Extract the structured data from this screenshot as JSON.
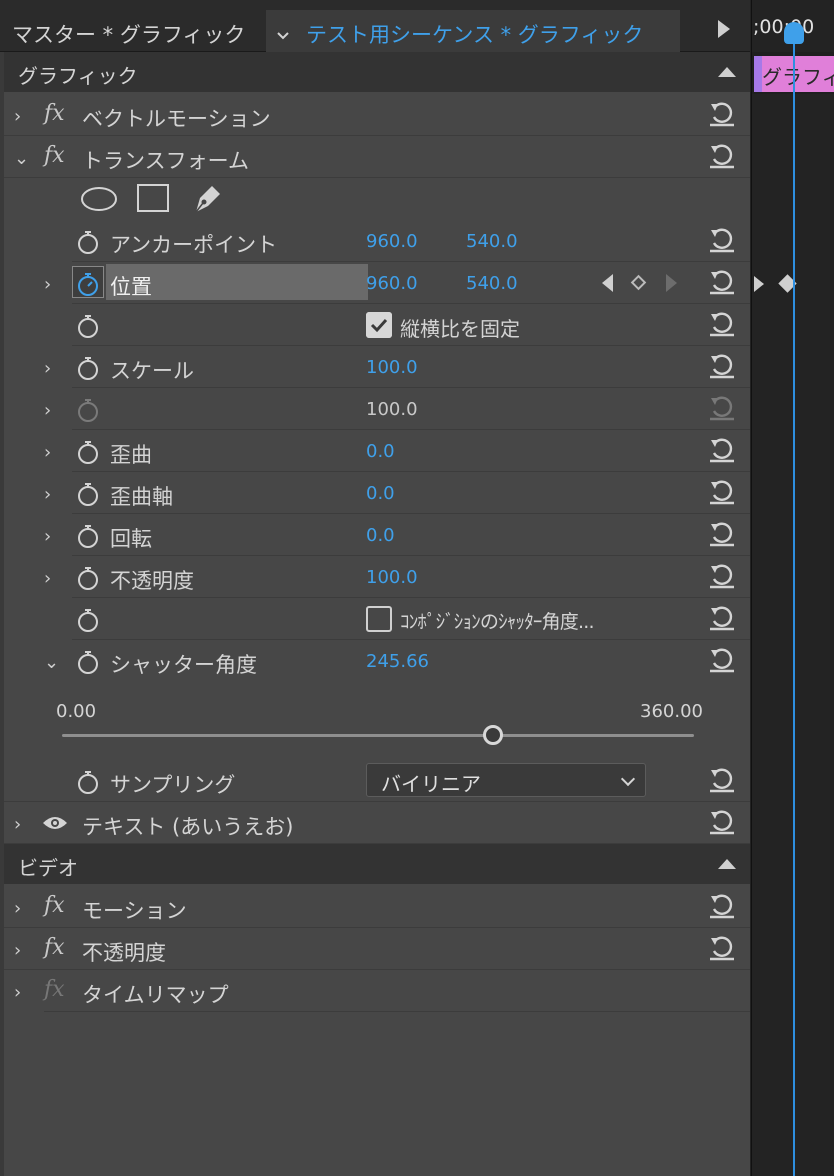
{
  "tabs": {
    "master": "マスター * グラフィック",
    "sequence": "テスト用シーケンス * グラフィック"
  },
  "timeline": {
    "timecode": ";00;00",
    "clip_label": "グラフィ"
  },
  "sections": {
    "graphics": "グラフィック",
    "video": "ビデオ"
  },
  "effects": {
    "vector_motion": "ベクトルモーション",
    "transform": "トランスフォーム",
    "text": "テキスト (あいうえお)",
    "motion": "モーション",
    "opacity_video": "不透明度",
    "time_remap": "タイムリマップ"
  },
  "props": {
    "anchor": {
      "label": "アンカーポイント",
      "x": "960.0",
      "y": "540.0"
    },
    "position": {
      "label": "位置",
      "x": "960.0",
      "y": "540.0"
    },
    "uniform_scale": {
      "label": "縦横比を固定",
      "checked": true
    },
    "scale": {
      "label": "スケール",
      "value": "100.0"
    },
    "scale_width": {
      "value": "100.0"
    },
    "skew": {
      "label": "歪曲",
      "value": "0.0"
    },
    "skew_axis": {
      "label": "歪曲軸",
      "value": "0.0"
    },
    "rotation": {
      "label": "回転",
      "value": "0.0"
    },
    "opacity": {
      "label": "不透明度",
      "value": "100.0"
    },
    "comp_shutter": {
      "label": "ｺﾝﾎﾟｼﾞｼｮﾝのｼｬｯﾀｰ角度...",
      "checked": false
    },
    "shutter_angle": {
      "label": "シャッター角度",
      "value": "245.66"
    },
    "slider": {
      "min_label": "0.00",
      "max_label": "360.00",
      "fraction": 0.6824
    },
    "sampling": {
      "label": "サンプリング",
      "value": "バイリニア"
    }
  },
  "colors": {
    "accent": "#3fa0ea",
    "panel": "#474747",
    "header": "#333333",
    "clip": "#e07fd9"
  }
}
